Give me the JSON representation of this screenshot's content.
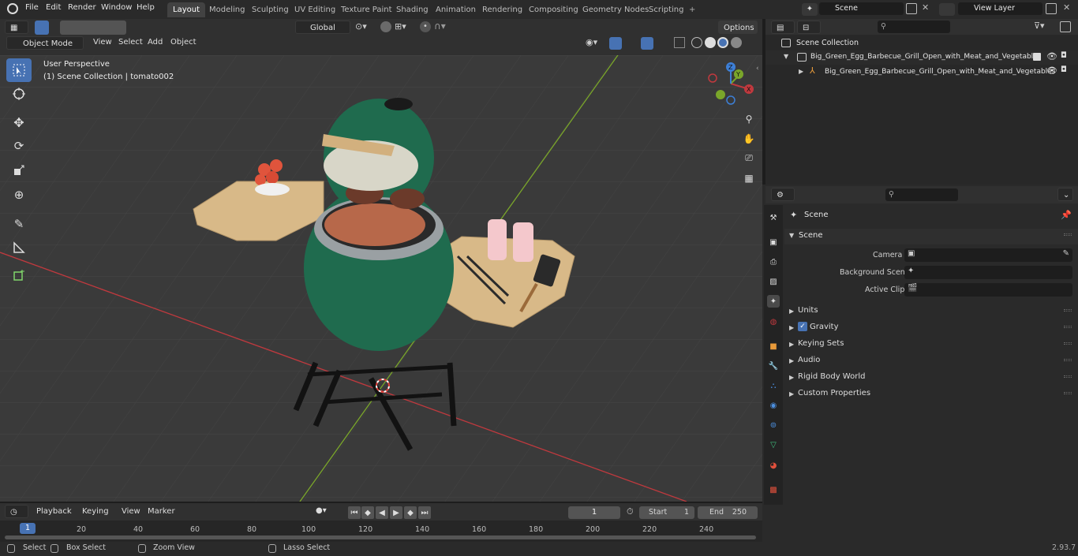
{
  "menu": {
    "file": "File",
    "edit": "Edit",
    "render": "Render",
    "window": "Window",
    "help": "Help"
  },
  "workspaces": [
    "Layout",
    "Modeling",
    "Sculpting",
    "UV Editing",
    "Texture Paint",
    "Shading",
    "Animation",
    "Rendering",
    "Compositing",
    "Geometry Nodes",
    "Scripting"
  ],
  "add_workspace": "+",
  "scene_field": "Scene",
  "viewlayer_field": "View Layer",
  "viewport": {
    "mode": "Object Mode",
    "menu": [
      "View",
      "Select",
      "Add",
      "Object"
    ],
    "transform_orientation": "Global",
    "options": "Options",
    "perspective": "User Perspective",
    "collection_info": "(1) Scene Collection | tomato002",
    "gizmo": {
      "x": "X",
      "y": "Y",
      "z": "Z"
    }
  },
  "outliner": {
    "root": "Scene Collection",
    "items": [
      {
        "label": "Big_Green_Egg_Barbecue_Grill_Open_with_Meat_and_Vegetables"
      },
      {
        "label": "Big_Green_Egg_Barbecue_Grill_Open_with_Meat_and_Vegetables"
      }
    ]
  },
  "properties": {
    "context": "Scene",
    "section": "Scene",
    "camera_label": "Camera",
    "background_label": "Background Scene",
    "clip_label": "Active Clip",
    "panels": [
      "Units",
      "Gravity",
      "Keying Sets",
      "Audio",
      "Rigid Body World",
      "Custom Properties"
    ],
    "gravity_checked": true
  },
  "timeline": {
    "menus": [
      "Playback",
      "Keying",
      "View",
      "Marker"
    ],
    "current_frame": "1",
    "start_label": "Start",
    "start": "1",
    "end_label": "End",
    "end": "250",
    "playhead": "1",
    "ticks": [
      "20",
      "40",
      "60",
      "80",
      "100",
      "120",
      "140",
      "160",
      "180",
      "200",
      "220",
      "240"
    ]
  },
  "statusbar": {
    "select": "Select",
    "box_select": "Box Select",
    "zoom_view": "Zoom View",
    "lasso_select": "Lasso Select",
    "version": "2.93.7"
  },
  "colors": {
    "accent": "#4772b3",
    "grill_green": "#1f6b4e",
    "x_axis": "#c0393e",
    "y_axis": "#7aa62a"
  }
}
